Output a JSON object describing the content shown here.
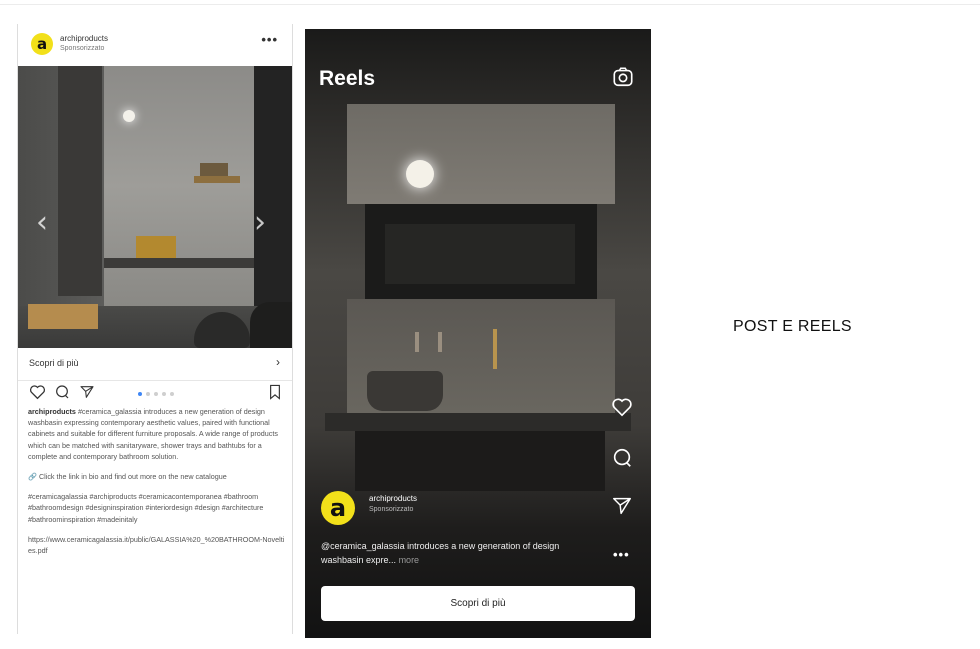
{
  "post": {
    "user": "archiproducts",
    "sponsored": "Sponsorizzato",
    "more": "•••",
    "avatar_letter": "a",
    "arrow_left": "‹",
    "arrow_right": "›",
    "cta_label": "Scopri di più",
    "cta_chevron": "›",
    "carousel_pages": 5,
    "carousel_active": 1,
    "caption_user": "archiproducts",
    "caption_text": "#ceramica_galassia introduces a new generation of design washbasin expressing contemporary aesthetic values, paired with functional cabinets and suitable for different furniture proposals. A wide range of products which can be matched with sanitaryware, shower trays and bathtubs for a complete and contemporary bathroom solution.",
    "caption_link_note": "🔗 Click the link in bio and find out more on the new catalogue",
    "hashtags": "#ceramicagalassia #archiproducts #ceramicacontemporanea #bathroom #bathroomdesign #designinspiration #interiordesign #design #architecture #bathroominspiration #madeinitaly",
    "url": "https://www.ceramicagalassia.it/public/GALASSIA%20_%20BATHROOM-Novelties.pdf"
  },
  "reels": {
    "title": "Reels",
    "avatar_letter": "a",
    "user": "archiproducts",
    "sponsored": "Sponsorizzato",
    "caption": "@ceramica_galassia introduces a new generation of design washbasin expre...",
    "caption_more": "more",
    "more": "•••",
    "cta_label": "Scopri di più"
  },
  "label": "POST E REELS",
  "colors": {
    "brand_yellow": "#f2e01a",
    "carousel_active": "#3f87f5"
  }
}
